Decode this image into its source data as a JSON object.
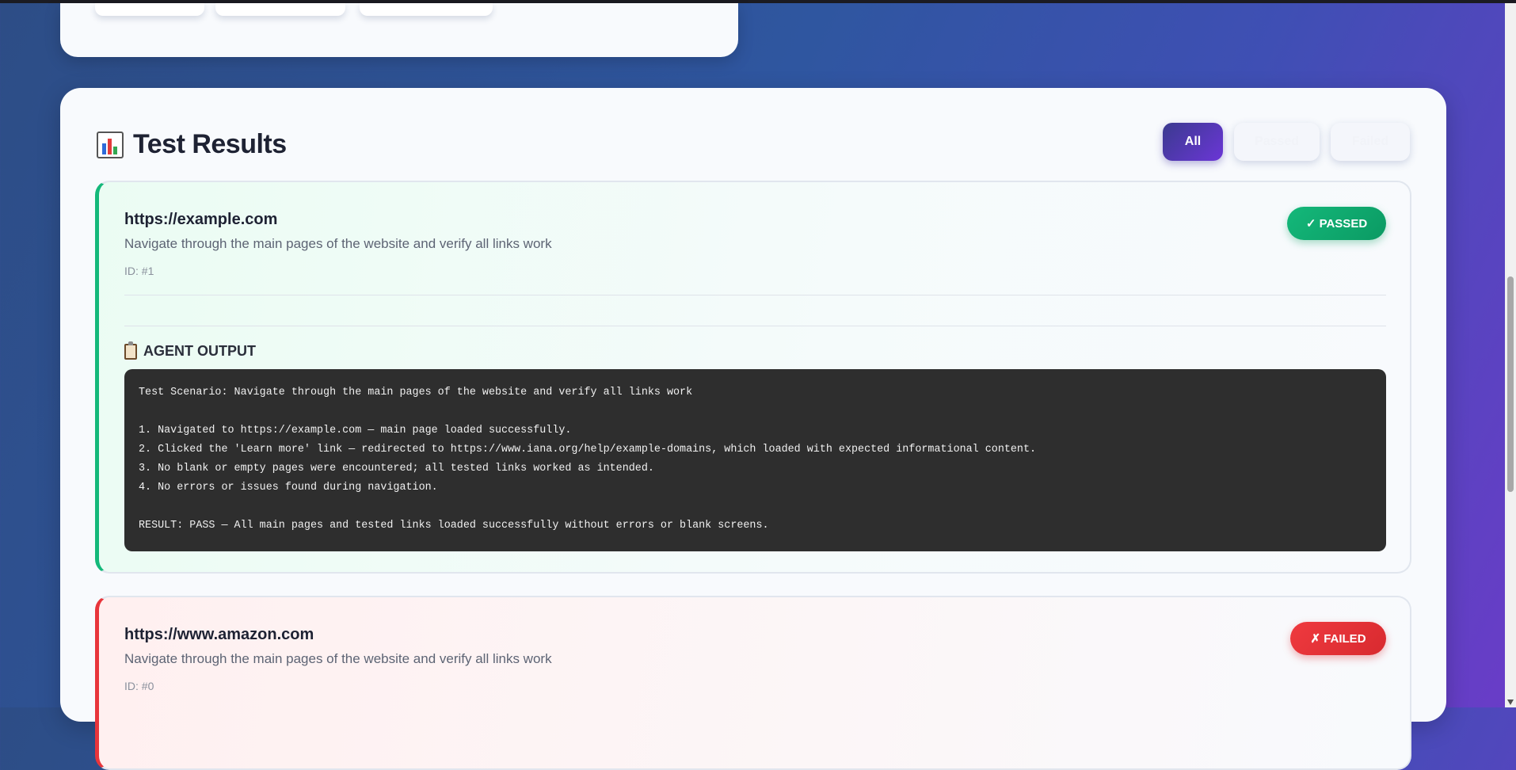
{
  "results_section": {
    "title": "Test Results",
    "icon": "bar-chart-icon",
    "filters": [
      "All",
      "Passed",
      "Failed"
    ],
    "active_filter": "All"
  },
  "tests": [
    {
      "url": "https://example.com",
      "description": "Navigate through the main pages of the website and verify all links work",
      "id_text": "ID: #1",
      "status": "✓ PASSED",
      "status_color": "#14b87a",
      "output_label": "AGENT OUTPUT",
      "output": "Test Scenario: Navigate through the main pages of the website and verify all links work\n\n1. Navigated to https://example.com — main page loaded successfully.\n2. Clicked the 'Learn more' link — redirected to https://www.iana.org/help/example-domains, which loaded with expected informational content.\n3. No blank or empty pages were encountered; all tested links worked as intended.\n4. No errors or issues found during navigation.\n\nRESULT: PASS — All main pages and tested links loaded successfully without errors or blank screens."
    },
    {
      "url": "https://www.amazon.com",
      "description": "Navigate through the main pages of the website and verify all links work",
      "id_text": "ID: #0",
      "status": "✗ FAILED",
      "status_color": "#e8353b"
    }
  ]
}
